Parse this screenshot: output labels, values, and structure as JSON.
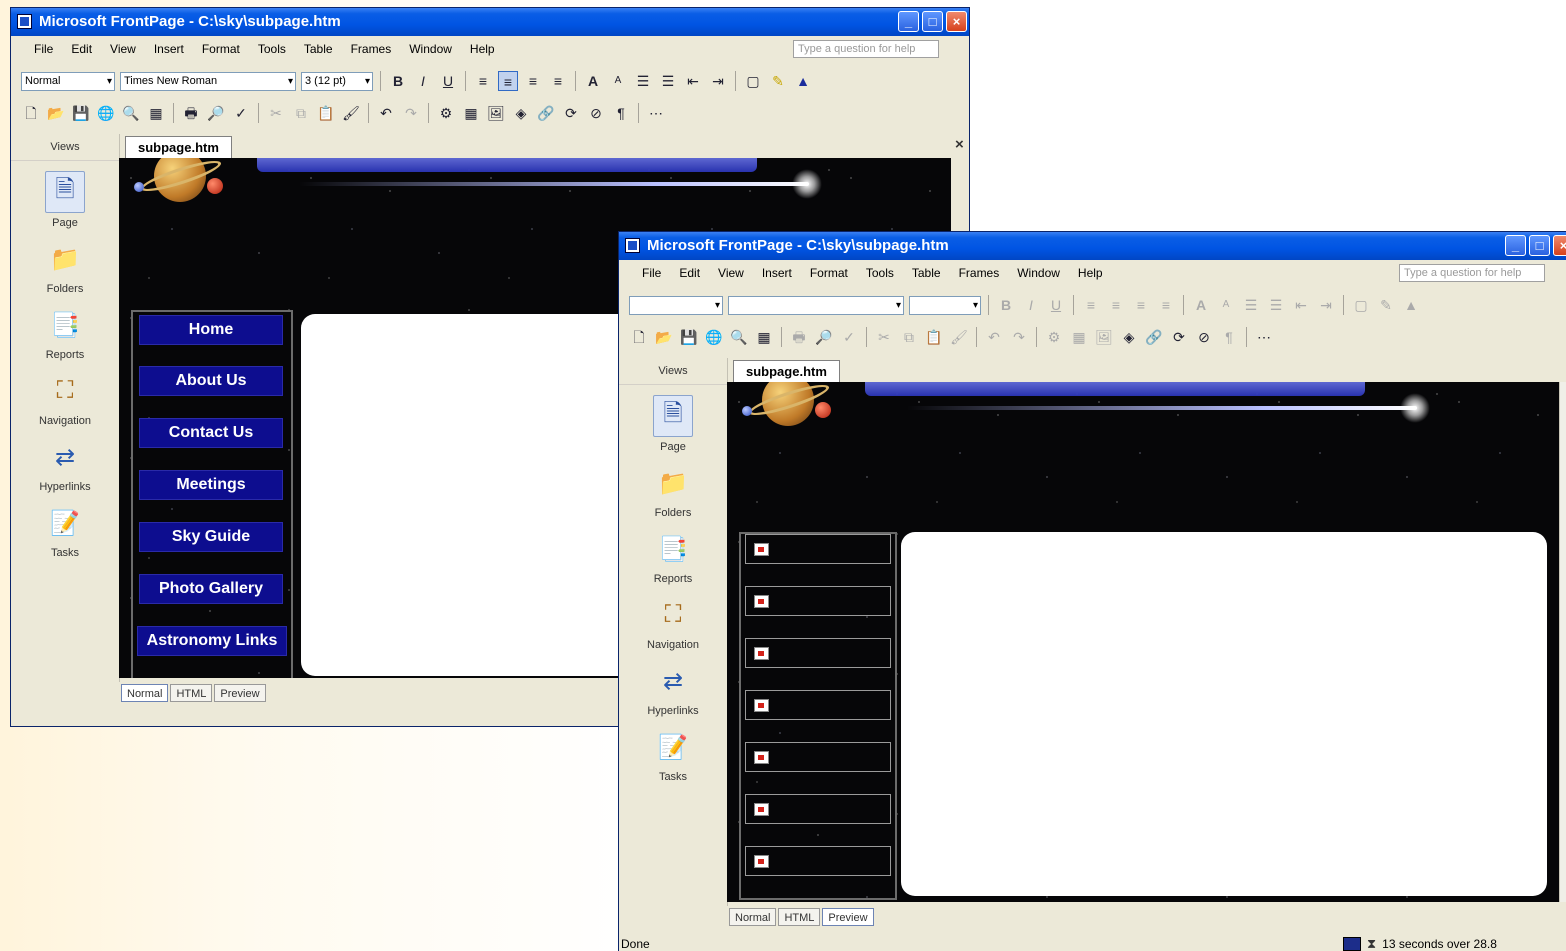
{
  "window1": {
    "title": "Microsoft FrontPage - C:\\sky\\subpage.htm",
    "menu": [
      "File",
      "Edit",
      "View",
      "Insert",
      "Format",
      "Tools",
      "Table",
      "Frames",
      "Window",
      "Help"
    ],
    "help_placeholder": "Type a question for help",
    "format_toolbar": {
      "style": "Normal",
      "font": "Times New Roman",
      "size": "3 (12 pt)"
    },
    "views_header": "Views",
    "views": [
      "Page",
      "Folders",
      "Reports",
      "Navigation",
      "Hyperlinks",
      "Tasks"
    ],
    "doc_tab": "subpage.htm",
    "nav_buttons": [
      "Home",
      "About Us",
      "Contact Us",
      "Meetings",
      "Sky Guide",
      "Photo Gallery",
      "Astronomy Links"
    ],
    "bottom_tabs": [
      "Normal",
      "HTML",
      "Preview"
    ],
    "active_bottom_tab": "Normal"
  },
  "window2": {
    "title": "Microsoft FrontPage - C:\\sky\\subpage.htm",
    "menu": [
      "File",
      "Edit",
      "View",
      "Insert",
      "Format",
      "Tools",
      "Table",
      "Frames",
      "Window",
      "Help"
    ],
    "help_placeholder": "Type a question for help",
    "views_header": "Views",
    "views": [
      "Page",
      "Folders",
      "Reports",
      "Navigation",
      "Hyperlinks",
      "Tasks"
    ],
    "doc_tab": "subpage.htm",
    "nav_placeholder_count": 7,
    "bottom_tabs": [
      "Normal",
      "HTML",
      "Preview"
    ],
    "active_bottom_tab": "Preview",
    "status_left": "Done",
    "status_right": "13 seconds over 28.8"
  },
  "icons": {
    "views": [
      "page-view-icon",
      "folders-view-icon",
      "reports-view-icon",
      "navigation-view-icon",
      "hyperlinks-view-icon",
      "tasks-view-icon"
    ],
    "toolbar": [
      "new-icon",
      "open-icon",
      "save-icon",
      "publish-icon",
      "print-icon",
      "print-preview-icon",
      "spelling-icon",
      "cut-icon",
      "copy-icon",
      "paste-icon",
      "undo-icon",
      "redo-icon",
      "table-icon",
      "picture-icon",
      "hyperlink-icon",
      "show-all-icon"
    ]
  },
  "colors": {
    "title_bar": "#0054e3",
    "nav_button": "#0d0d8f",
    "canvas_bg": "#060608",
    "chrome": "#ece9d8"
  }
}
